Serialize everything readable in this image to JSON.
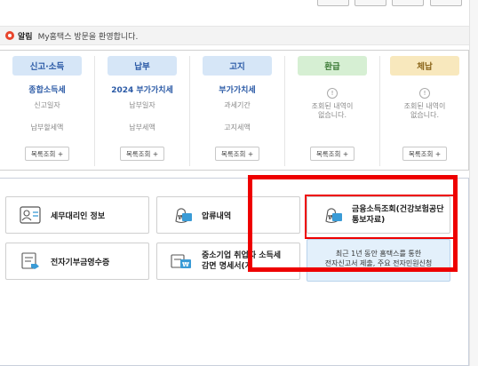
{
  "notice": {
    "title": "알림",
    "text": "My홈택스 방문을 환영합니다."
  },
  "status": [
    {
      "category": "신고·소득",
      "main": "종합소득세",
      "line1": "신고일자",
      "line2": "납부할세액",
      "more": "목록조회 +"
    },
    {
      "category": "납부",
      "main": "2024 부가가치세",
      "line1": "납부일자",
      "line2": "납부세액",
      "more": "목록조회 +"
    },
    {
      "category": "고지",
      "main": "부가가치세",
      "line1": "과세기간",
      "line2": "고지세액",
      "more": "목록조회 +"
    },
    {
      "category": "환급",
      "empty1": "조회된 내역이",
      "empty2": "없습니다.",
      "more": "목록조회 +"
    },
    {
      "category": "체납",
      "empty1": "조회된 내역이",
      "empty2": "없습니다.",
      "more": "목록조회 +"
    }
  ],
  "services": {
    "tax_agent": "세무대리인 정보",
    "seizure": "압류내역",
    "finance_line1": "금융소득조회(건강보험공단",
    "finance_line2": "통보자료)",
    "donation": "전자기부금영수증",
    "sme_line1": "중소기업 취업자 소득세",
    "sme_line2": "감면 명세서(개",
    "info_line1": "최근 1년 동안 홈택스를 통한",
    "info_line2": "전자신고서 제출, 주요 전자민원신청"
  }
}
